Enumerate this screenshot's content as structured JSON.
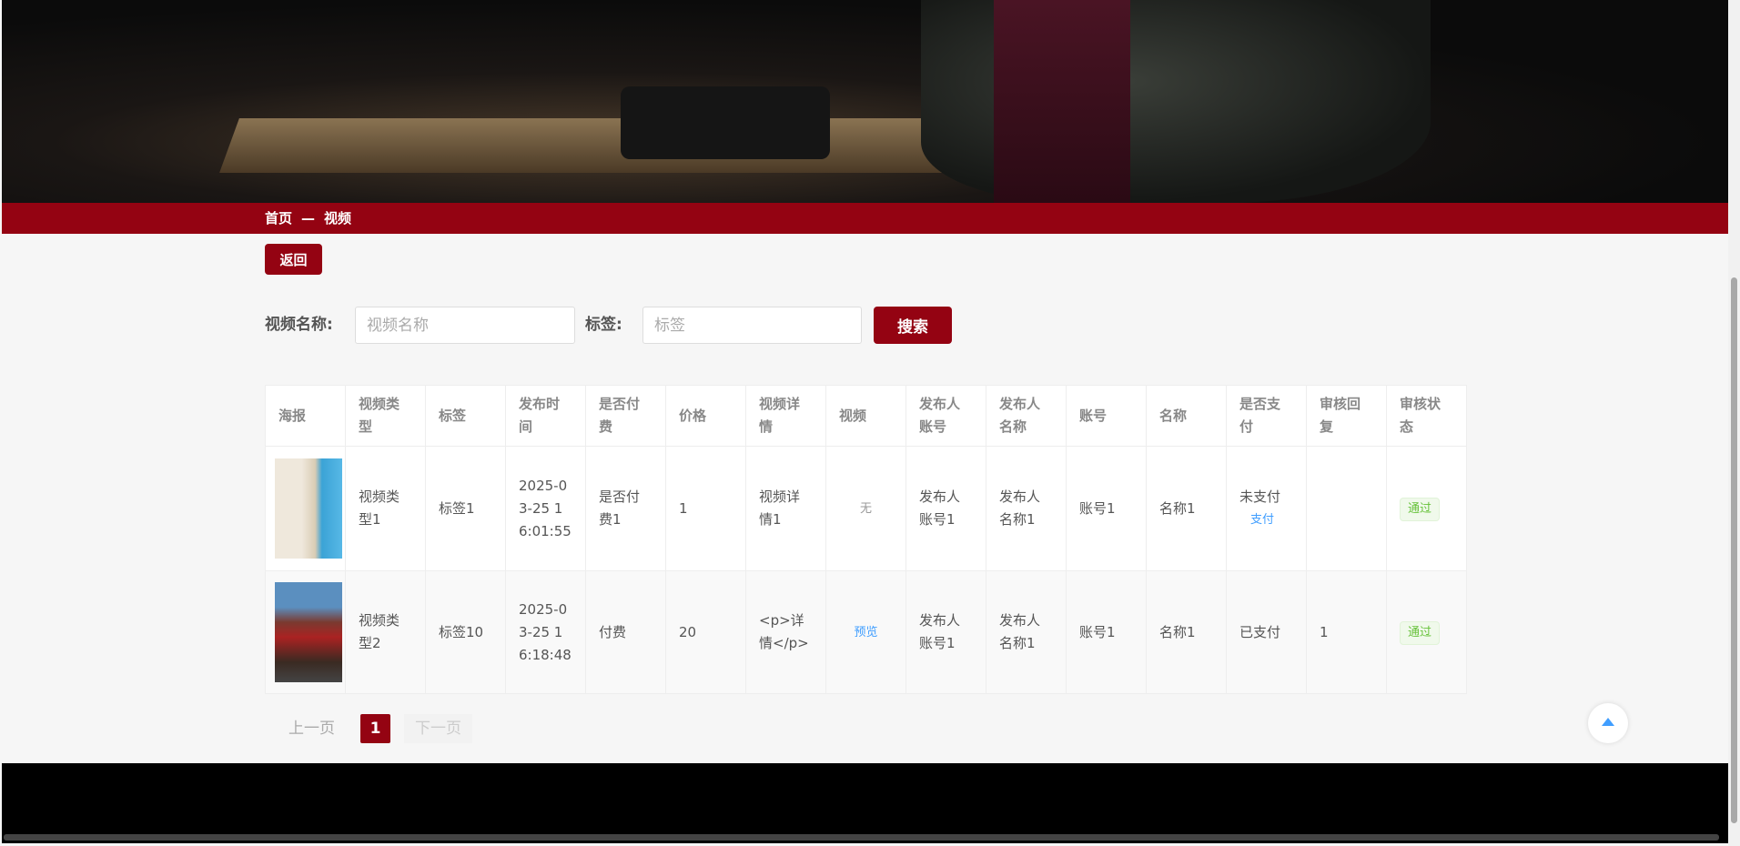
{
  "breadcrumb": {
    "home": "首页",
    "sep": "—",
    "current": "视频"
  },
  "back_label": "返回",
  "search": {
    "name_label": "视频名称:",
    "name_placeholder": "视频名称",
    "tag_label": "标签:",
    "tag_placeholder": "标签",
    "button": "搜索"
  },
  "table": {
    "headers": [
      "海报",
      "视频类型",
      "标签",
      "发布时间",
      "是否付费",
      "价格",
      "视频详情",
      "视频",
      "发布人账号",
      "发布人名称",
      "账号",
      "名称",
      "是否支付",
      "审核回复",
      "审核状态"
    ],
    "rows": [
      {
        "type": "视频类型1",
        "tag": "标签1",
        "time": "2025-03-25 16:01:55",
        "paid": "是否付费1",
        "price": "1",
        "detail": "视频详情1",
        "video": "无",
        "pub_account": "发布人账号1",
        "pub_name": "发布人名称1",
        "account": "账号1",
        "name": "名称1",
        "pay_status": "未支付",
        "pay_link": "支付",
        "reply": "",
        "status": "通过"
      },
      {
        "type": "视频类型2",
        "tag": "标签10",
        "time": "2025-03-25 16:18:48",
        "paid": "付费",
        "price": "20",
        "detail": "<p>详情</p>",
        "video": "预览",
        "pub_account": "发布人账号1",
        "pub_name": "发布人名称1",
        "account": "账号1",
        "name": "名称1",
        "pay_status": "已支付",
        "pay_link": "",
        "reply": "1",
        "status": "通过"
      }
    ]
  },
  "pagination": {
    "prev": "上一页",
    "current": "1",
    "next": "下一页"
  },
  "colors": {
    "brand": "#940312",
    "link": "#409eff",
    "success": "#67c23a"
  }
}
